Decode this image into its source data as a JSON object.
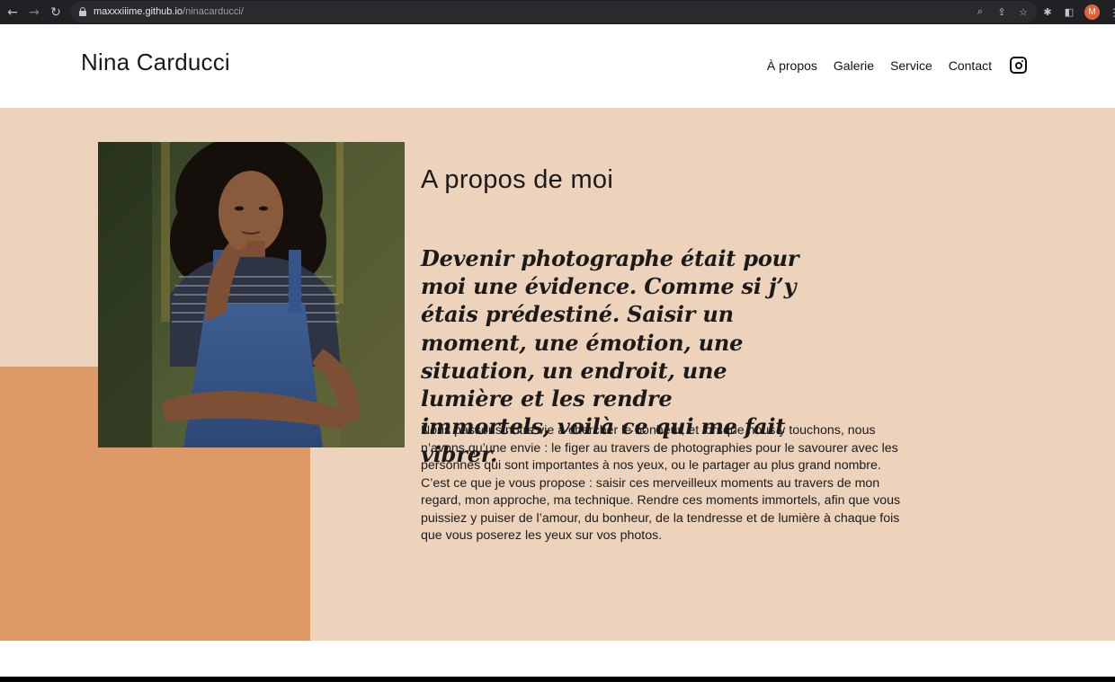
{
  "browser": {
    "url_host": "maxxxiiime.github.io",
    "url_path": "/ninacarducci/",
    "avatar_letter": "M",
    "icons": [
      "back-arrow-icon",
      "forward-arrow-icon",
      "reload-icon",
      "lock-icon",
      "zoom-icon",
      "share-icon",
      "bookmark-star-icon",
      "extensions-puzzle-icon",
      "side-panel-icon",
      "menu-kebab-icon"
    ]
  },
  "header": {
    "brand": "Nina Carducci",
    "nav": [
      {
        "label": "À propos"
      },
      {
        "label": "Galerie"
      },
      {
        "label": "Service"
      },
      {
        "label": "Contact"
      }
    ],
    "social_icon": "instagram-icon"
  },
  "about": {
    "title": "A propos de moi",
    "quote": "Devenir photographe était pour moi une évidence. Comme si j’y étais prédestiné. Saisir un moment, une émotion, une situation, un endroit, une lumière et les rendre immortels, voilà ce qui me fait vibrer.",
    "body": "Nous passons notre vie à chercher le bonheur, et lorsque nous y touchons, nous n’avons qu’une envie : le figer au travers de photographies pour le savourer avec les personnes qui sont importantes à nos yeux, ou le partager au plus grand nombre. C’est ce que je vous propose : saisir ces merveilleux moments au travers de mon regard, mon approche, ma technique. Rendre ces moments immortels, afin que vous puissiez y puiser de l’amour, du bonheur, de la tendresse et de lumière à chaque fois que vous poserez les yeux sur vos photos.",
    "photo": "portrait-photo-woman-in-denim-overalls"
  },
  "colors": {
    "section_bg": "#eed3bc",
    "accent_block": "#dd9a66",
    "text": "#1a1a1a",
    "chrome_bg": "#202124"
  }
}
